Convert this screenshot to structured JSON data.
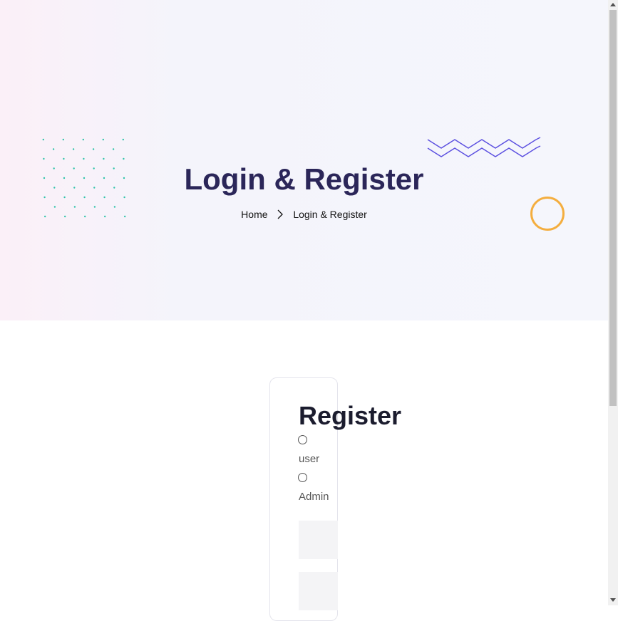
{
  "hero": {
    "title": "Login & Register",
    "breadcrumb": {
      "home": "Home",
      "current": "Login & Register"
    }
  },
  "register": {
    "title": "Register",
    "roles": [
      {
        "label": "user",
        "checked": false
      },
      {
        "label": "Admin",
        "checked": false
      }
    ],
    "fields": [
      {
        "value": "",
        "placeholder": ""
      },
      {
        "value": "",
        "placeholder": ""
      }
    ]
  },
  "colors": {
    "title": "#2b2659",
    "dots": "#2ec4a9",
    "zigzag": "#5b4fe0",
    "ring": "#f4ae3f"
  }
}
